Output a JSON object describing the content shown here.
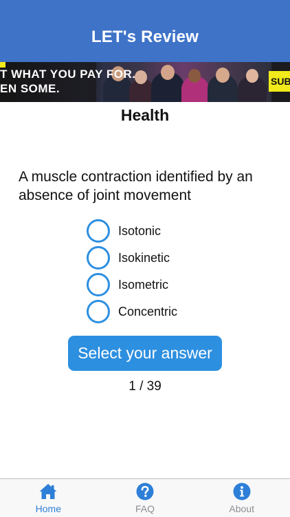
{
  "app": {
    "title": "LET's Review"
  },
  "ad": {
    "line1": "T WHAT YOU PAY FOR.",
    "line2": "EN SOME.",
    "cta": "SUB"
  },
  "quiz": {
    "category": "Health",
    "question": "A muscle contraction identified by an absence of joint movement",
    "options": [
      {
        "label": "Isotonic"
      },
      {
        "label": "Isokinetic"
      },
      {
        "label": "Isometric"
      },
      {
        "label": "Concentric"
      }
    ],
    "button_label": "Select your answer",
    "progress": "1 / 39",
    "current": 1,
    "total": 39
  },
  "tabs": [
    {
      "label": "Home",
      "icon": "home-icon",
      "active": true
    },
    {
      "label": "FAQ",
      "icon": "question-circle-icon",
      "active": false
    },
    {
      "label": "About",
      "icon": "info-circle-icon",
      "active": false
    }
  ],
  "colors": {
    "nav_bar": "#3e73c8",
    "accent": "#2d8fe0",
    "tab_active": "#2d7fd8",
    "tab_inactive": "#8e8e93"
  }
}
